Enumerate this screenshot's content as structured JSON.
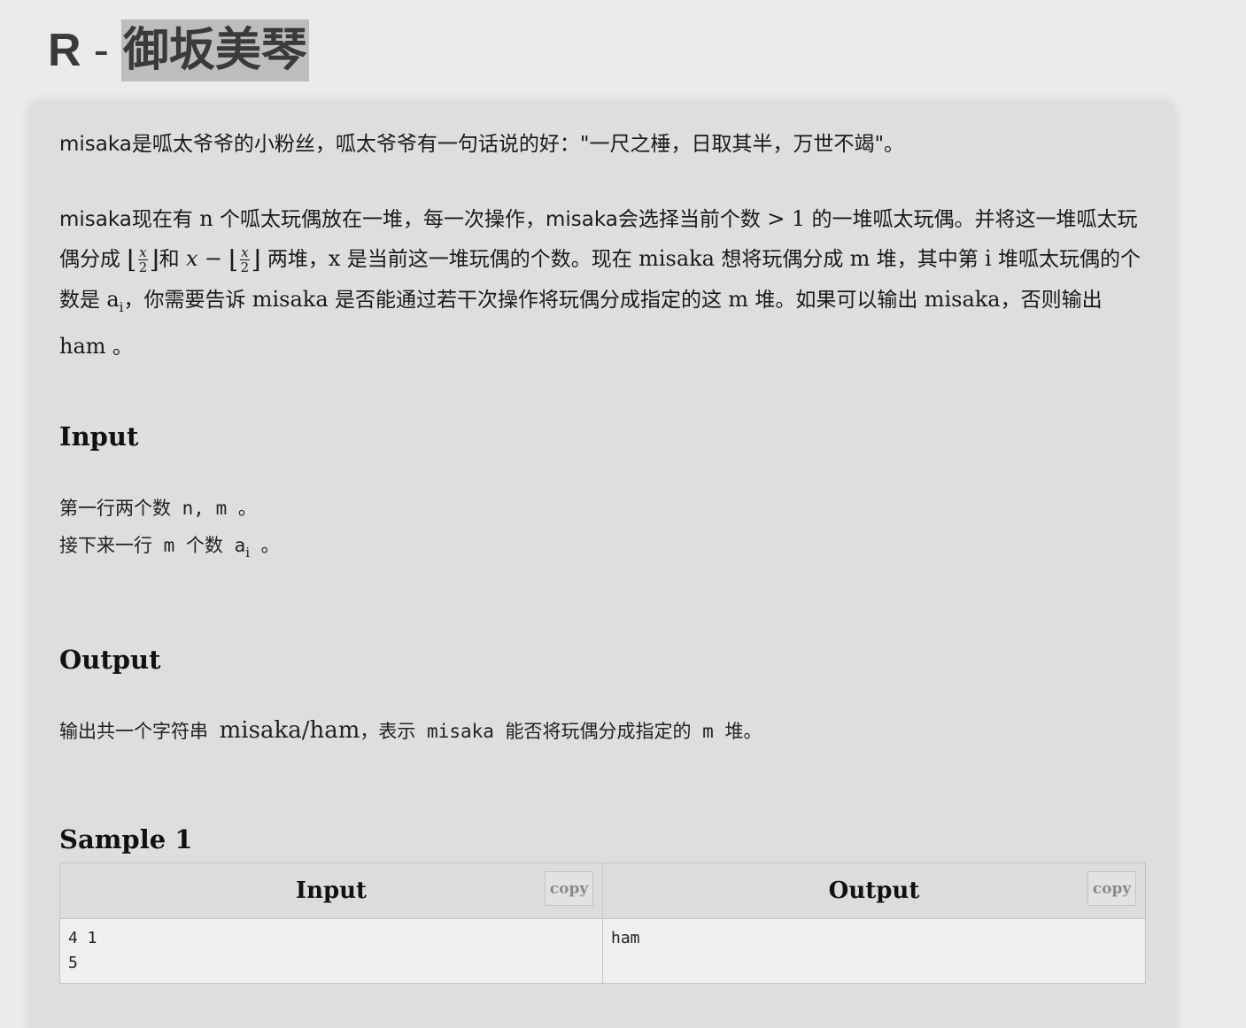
{
  "problem": {
    "letter": "R",
    "separator": "-",
    "name": "御坂美琴"
  },
  "description": {
    "p1": "misaka是呱太爷爷的小粉丝，呱太爷爷有一句话说的好：\"一尺之棰，日取其半，万世不竭\"。",
    "p2_a": "misaka现在有",
    "p2_n": "n",
    "p2_b": "个呱太玩偶放在一堆，每一次操作，misaka会选择当前个数",
    "p2_cond": "> 1",
    "p2_c": "的一堆呱太玩偶。并将这一堆呱太玩偶分成",
    "frac_num": "x",
    "frac_den": "2",
    "p2_and": "和",
    "p2_x": "x",
    "p2_minus": "−",
    "p2_d": "两堆，",
    "p2_x2": "x",
    "p2_e": "是当前这一堆玩偶的个数。现在",
    "p2_misaka1": "misaka",
    "p2_f": "想将玩偶分成",
    "p2_m1": "m",
    "p2_g": "堆，其中第",
    "p2_i": "i",
    "p2_h": "堆呱太玩偶的个数是",
    "p2_a_var": "a",
    "p2_i_sub": "i",
    "p2_j": "，你需要告诉",
    "p2_misaka2": "misaka",
    "p2_k": "是否能通过若干次操作将玩偶分成指定的这",
    "p2_m2": "m",
    "p2_l": "堆。如果可以输出",
    "p2_misaka3": "misaka",
    "p2_mm": "，否则输出",
    "p2_ham": "ham",
    "p2_end": "。"
  },
  "input_section": {
    "heading": "Input",
    "line1_a": "第一行两个数 n, m 。",
    "line2_a": "接下来一行 m 个数 a",
    "line2_sub": "i",
    "line2_b": " 。"
  },
  "output_section": {
    "heading": "Output",
    "line_a": "输出共一个字符串",
    "line_math": "misaka/ham",
    "line_b": "，表示 misaka 能否将玩偶分成指定的 m 堆。"
  },
  "sample": {
    "heading": "Sample 1",
    "input_header": "Input",
    "output_header": "Output",
    "copy_label": "copy",
    "input_value": "4 1\n5",
    "output_value": "ham"
  }
}
